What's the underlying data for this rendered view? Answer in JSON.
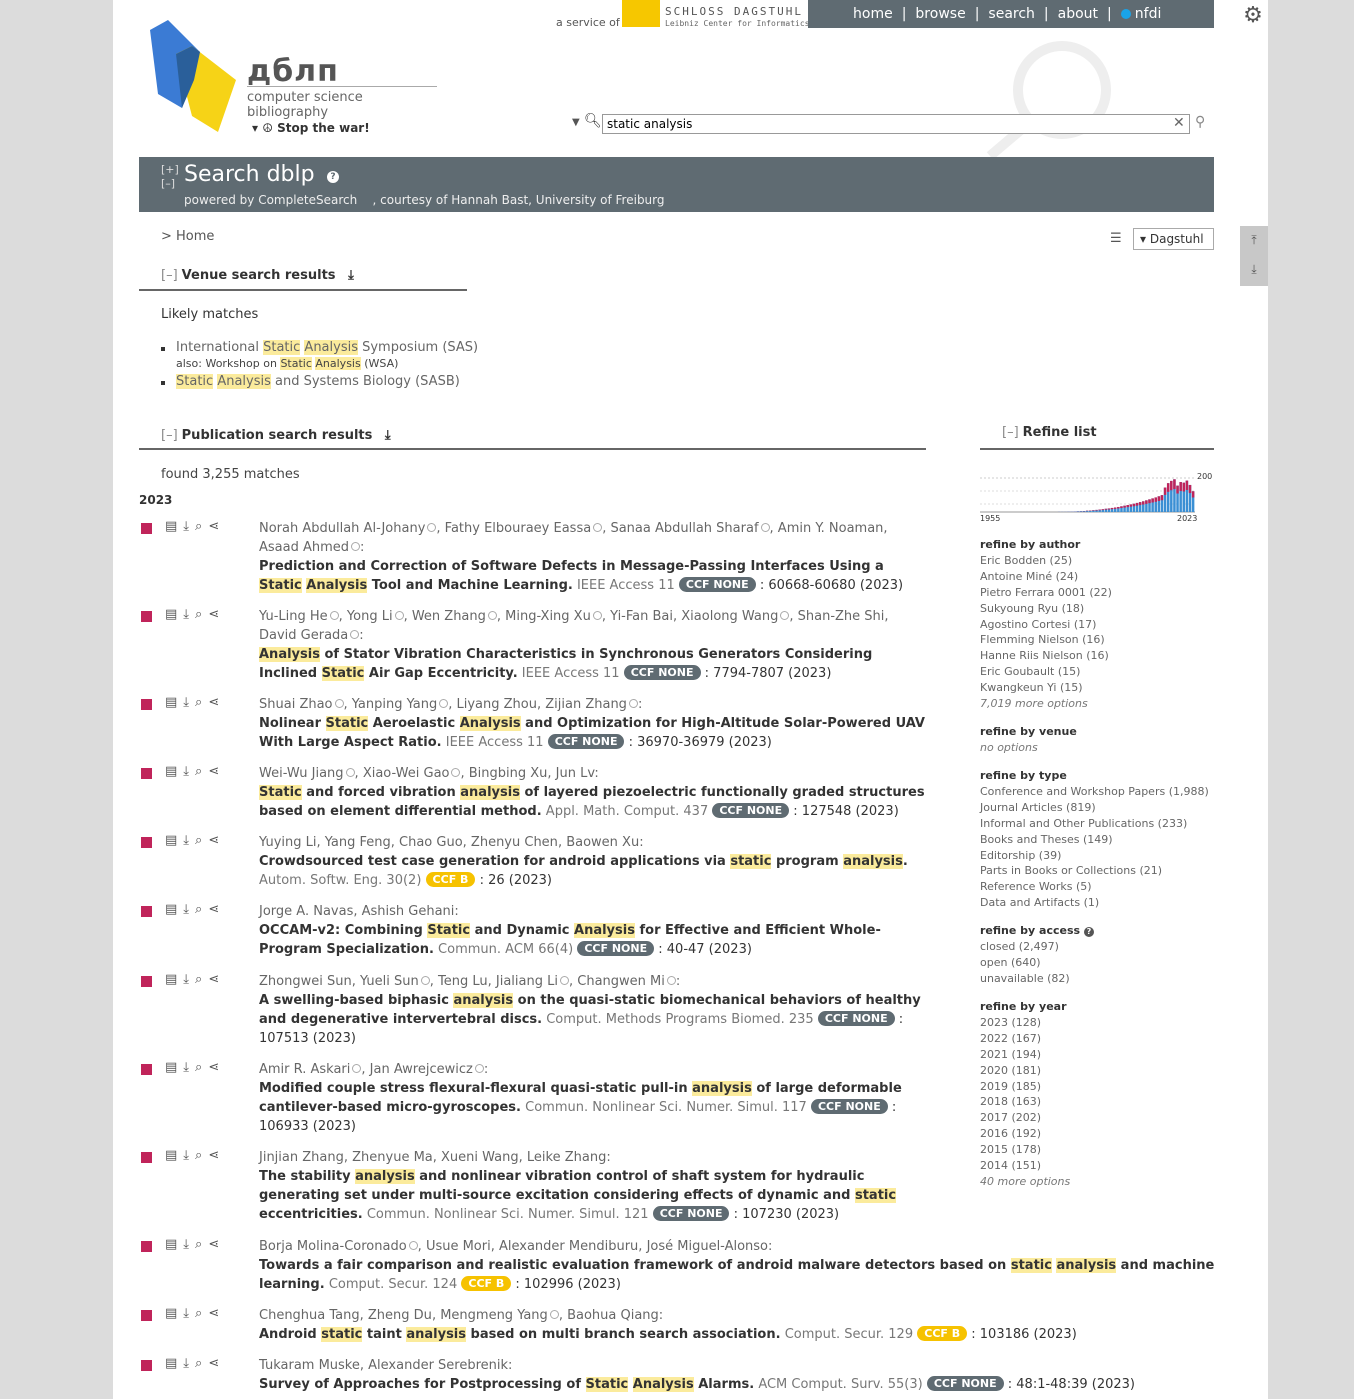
{
  "logo": {
    "word": "дблп",
    "subtitle": "computer science bibliography",
    "stopwar": "Stop the war!"
  },
  "service": {
    "prefix": "a service of",
    "org1": "SCHLOSS DAGSTUHL",
    "org2": "Leibniz Center for Informatics"
  },
  "nav": {
    "home": "home",
    "browse": "browse",
    "search": "search",
    "about": "about",
    "nfdi": "nfdi"
  },
  "search": {
    "value": "static analysis"
  },
  "banner": {
    "title": "Search dblp",
    "powered_prefix": "powered by",
    "powered_name": "CompleteSearch",
    "courtesy": ", courtesy of Hannah Bast, University of Freiburg"
  },
  "breadcrumb": "> Home",
  "mirror": "Dagstuhl",
  "venue_section": {
    "title": "Venue search results",
    "likely": "Likely matches",
    "items": [
      {
        "pre": "International ",
        "hl1": "Static",
        "mid": " ",
        "hl2": "Analysis",
        "post": " Symposium (SAS)"
      },
      {
        "pre": "",
        "hl1": "Static",
        "mid": " ",
        "hl2": "Analysis",
        "post": " and Systems Biology (SASB)"
      }
    ],
    "also": {
      "pre": "also: Workshop on ",
      "hl1": "Static",
      "mid": " ",
      "hl2": "Analysis",
      "post": " (WSA)"
    }
  },
  "pub_section": {
    "title": "Publication search results",
    "found": "found 3,255 matches",
    "year": "2023"
  },
  "refine": {
    "title": "Refine list",
    "chart": {
      "type": "bar",
      "x_start": "1955",
      "x_end": "2023",
      "y_max_label": "200"
    },
    "author": {
      "head": "refine by author",
      "items": [
        "Eric Bodden (25)",
        "Antoine Miné (24)",
        "Pietro Ferrara 0001 (22)",
        "Sukyoung Ryu (18)",
        "Agostino Cortesi (17)",
        "Flemming Nielson (16)",
        "Hanne Riis Nielson (16)",
        "Eric Goubault (15)",
        "Kwangkeun Yi (15)"
      ],
      "more": "7,019 more options"
    },
    "venue": {
      "head": "refine by venue",
      "none": "no options"
    },
    "type": {
      "head": "refine by type",
      "items": [
        "Conference and Workshop Papers (1,988)",
        "Journal Articles (819)",
        "Informal and Other Publications (233)",
        "Books and Theses (149)",
        "Editorship (39)",
        "Parts in Books or Collections (21)",
        "Reference Works (5)",
        "Data and Artifacts (1)"
      ]
    },
    "access": {
      "head": "refine by access",
      "items": [
        "closed (2,497)",
        "open (640)",
        "unavailable (82)"
      ]
    },
    "year": {
      "head": "refine by year",
      "items": [
        "2023 (128)",
        "2022 (167)",
        "2021 (194)",
        "2020 (181)",
        "2019 (185)",
        "2018 (163)",
        "2017 (202)",
        "2016 (192)",
        "2015 (178)",
        "2014 (151)"
      ],
      "more": "40 more options"
    }
  }
}
